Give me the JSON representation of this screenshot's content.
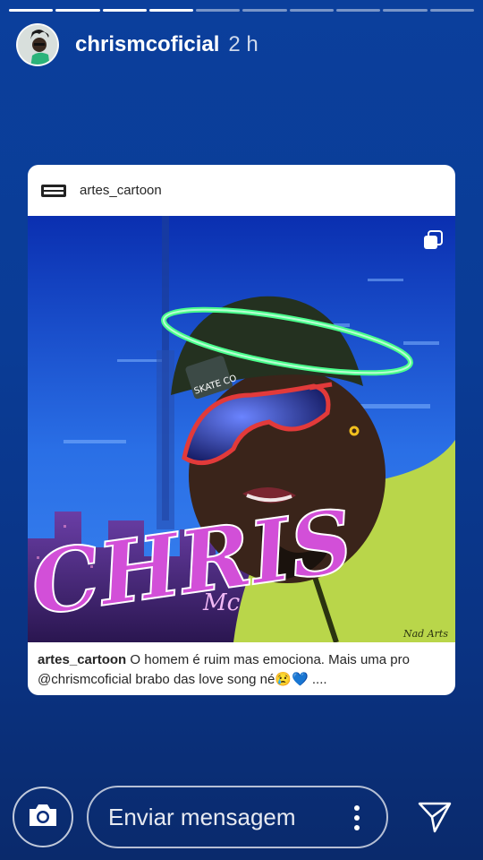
{
  "story": {
    "segments_total": 10,
    "segments_done": 4
  },
  "header": {
    "username": "chrismcoficial",
    "time": "2 h",
    "avatar_icon": "profile-avatar"
  },
  "post": {
    "username": "artes_cartoon",
    "logo_icon": "skate-logo-icon",
    "image_description_icon": "cartoon-portrait",
    "image_text": {
      "name": "CHRIS",
      "suffix": "Mc",
      "cap_brand": "SKATE CO",
      "signature": "Nad Arts"
    },
    "multi_icon": "carousel-icon",
    "caption_user": "artes_cartoon",
    "caption_text": " O homem é ruim mas emociona. Mais uma pro @chrismcoficial brabo das love song né😢💙 ...."
  },
  "footer": {
    "camera_icon": "camera-icon",
    "message_placeholder": "Enviar mensagem",
    "more_icon": "more-vertical-icon",
    "send_icon": "send-icon"
  },
  "colors": {
    "background": "#0b3f9c",
    "halo": "#49ff8c",
    "name_art": "#d24fd8",
    "card": "#ffffff"
  }
}
